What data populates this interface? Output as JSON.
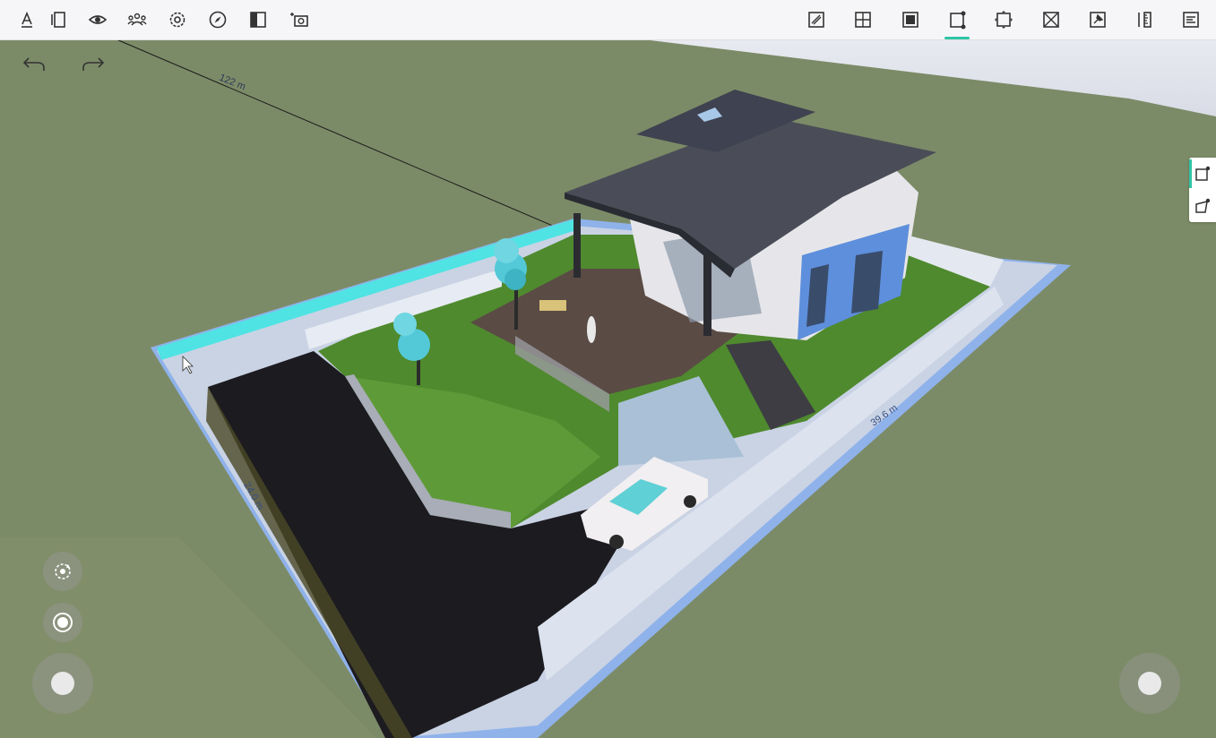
{
  "toolbar": {
    "left_icons": [
      "text-edit-icon",
      "panels-icon",
      "eye-icon",
      "people-icon",
      "settings-icon",
      "compass-icon",
      "split-view-icon",
      "ar-camera-icon"
    ],
    "right_icons": [
      "draw-area-icon",
      "grid-cross-icon",
      "fill-square-icon",
      "edit-corners-icon",
      "resize-frame-icon",
      "cross-box-icon",
      "pin-icon",
      "ruler-icon",
      "text-align-icon"
    ],
    "active_right_index": 3,
    "accent_color": "#2fc4a4"
  },
  "history": {
    "undo_icon": "undo-arrow-icon",
    "redo_icon": "redo-arrow-icon"
  },
  "side_panel": {
    "items": [
      "rectangle-node-icon",
      "polygon-node-icon"
    ],
    "active_index": 0
  },
  "view_controls": {
    "orbit": "orbit-rotate-icon",
    "center": "center-target-icon"
  },
  "dimensions": {
    "top_edge": "122 m",
    "left_edge": "24.0 m",
    "right_edge": "39.6 m"
  },
  "colors": {
    "ground": "#7b8a66",
    "highlight_edge": "#4fe3e3",
    "plot_border": "#8fb2ea"
  }
}
